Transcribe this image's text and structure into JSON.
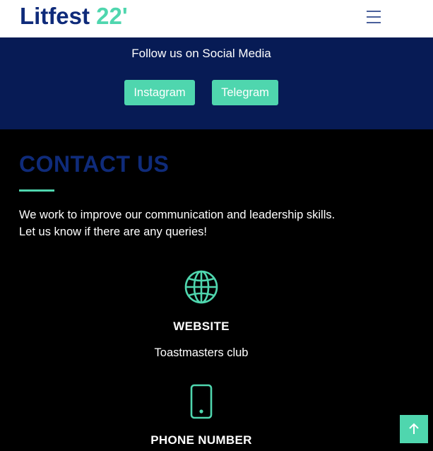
{
  "header": {
    "brand_name": "Litfest",
    "brand_year": "22'",
    "menu_icon": "hamburger-menu-icon"
  },
  "social": {
    "heading": "Follow us on Social Media",
    "buttons": [
      {
        "label": "Instagram"
      },
      {
        "label": "Telegram"
      }
    ]
  },
  "contact": {
    "title": "CONTACT US",
    "description_line1": "We work to improve our communication and leadership skills.",
    "description_line2": "Let us know if there are any queries!",
    "items": [
      {
        "icon": "globe-icon",
        "label": "WEBSITE",
        "value": "Toastmasters club"
      },
      {
        "icon": "smartphone-icon",
        "label": "PHONE NUMBER",
        "value": ""
      }
    ]
  },
  "back_to_top": {
    "icon": "arrow-up-icon"
  },
  "colors": {
    "brand_navy": "#0f2b7a",
    "accent_teal": "#4fd6ae",
    "social_band": "#071b55",
    "page_background": "#000000"
  }
}
